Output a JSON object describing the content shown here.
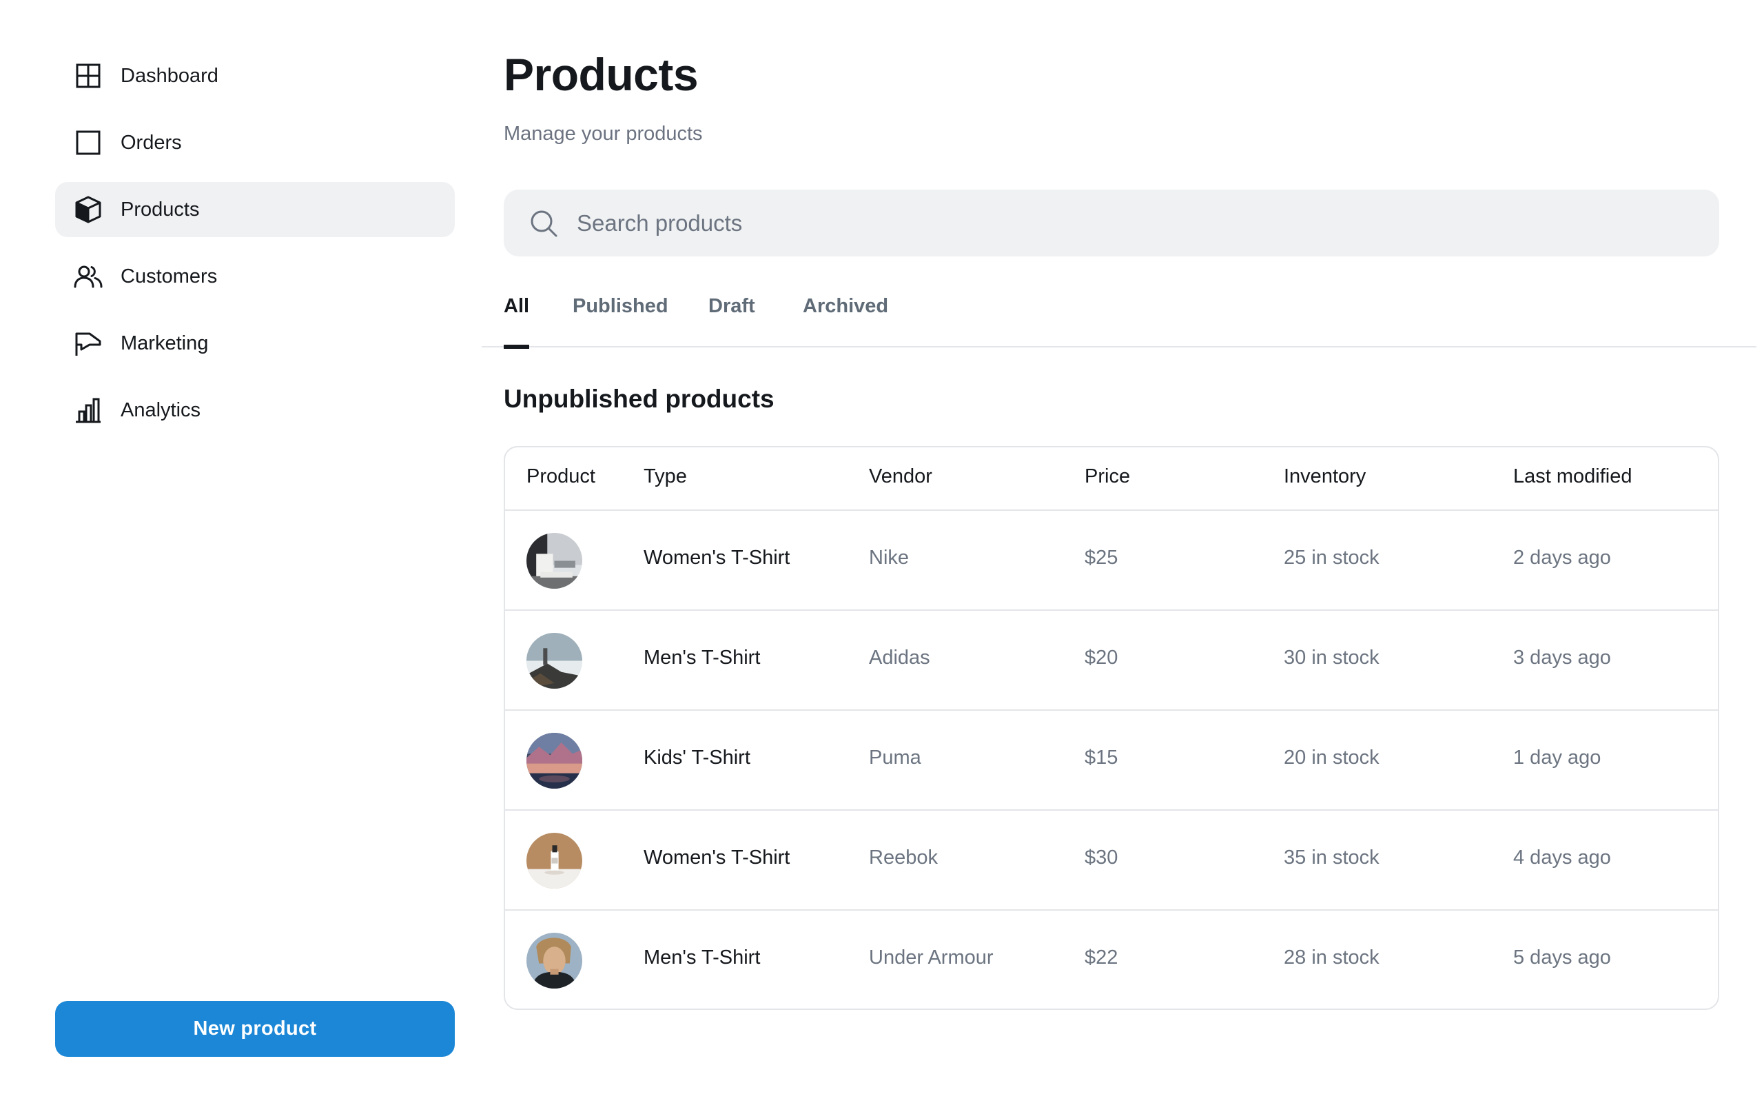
{
  "sidebar": {
    "items": [
      {
        "label": "Dashboard",
        "icon": "dashboard-grid-icon"
      },
      {
        "label": "Orders",
        "icon": "square-icon"
      },
      {
        "label": "Products",
        "icon": "box-icon",
        "active": true
      },
      {
        "label": "Customers",
        "icon": "users-icon"
      },
      {
        "label": "Marketing",
        "icon": "megaphone-icon"
      },
      {
        "label": "Analytics",
        "icon": "bar-chart-icon"
      }
    ],
    "new_button": "New product"
  },
  "header": {
    "title": "Products",
    "subtitle": "Manage your products"
  },
  "search": {
    "placeholder": "Search products",
    "icon": "search-icon"
  },
  "tabs": [
    {
      "label": "All",
      "active": true
    },
    {
      "label": "Published"
    },
    {
      "label": "Draft"
    },
    {
      "label": "Archived"
    }
  ],
  "section": {
    "title": "Unpublished products"
  },
  "table": {
    "columns": [
      "Product",
      "Type",
      "Vendor",
      "Price",
      "Inventory",
      "Last modified"
    ],
    "rows": [
      {
        "thumb": "interior-photo",
        "type": "Women's T-Shirt",
        "vendor": "Nike",
        "price": "$25",
        "inventory": "25 in stock",
        "modified": "2 days ago"
      },
      {
        "thumb": "coastal-photo",
        "type": "Men's T-Shirt",
        "vendor": "Adidas",
        "price": "$20",
        "inventory": "30 in stock",
        "modified": "3 days ago"
      },
      {
        "thumb": "mountain-lake-photo",
        "type": "Kids' T-Shirt",
        "vendor": "Puma",
        "price": "$15",
        "inventory": "20 in stock",
        "modified": "1 day ago"
      },
      {
        "thumb": "bottle-photo",
        "type": "Women's T-Shirt",
        "vendor": "Reebok",
        "price": "$30",
        "inventory": "35 in stock",
        "modified": "4 days ago"
      },
      {
        "thumb": "portrait-photo",
        "type": "Men's T-Shirt",
        "vendor": "Under Armour",
        "price": "$22",
        "inventory": "28 in stock",
        "modified": "5 days ago"
      }
    ]
  },
  "colors": {
    "accent": "#1b87d6",
    "active_nav_bg": "#f0f1f3",
    "muted_text": "#6b7480"
  }
}
